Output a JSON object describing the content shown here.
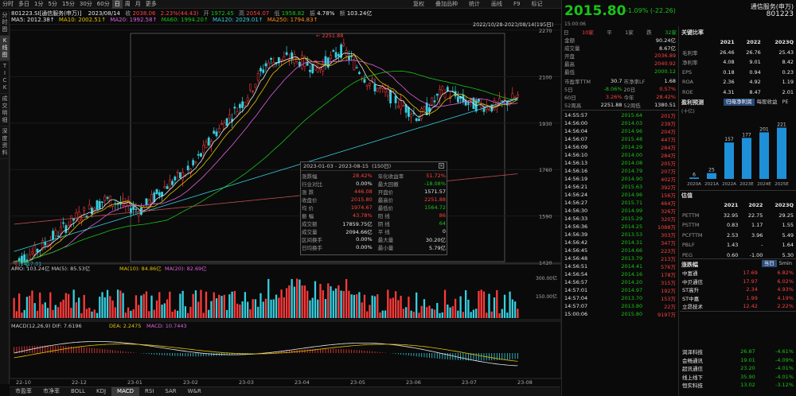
{
  "window": {
    "symbol_line": "801223.SI[通信服务(申万)]",
    "date": "2023/08/14",
    "close_label": "收",
    "close": "2038.06",
    "chg_pct": "2.23%(44.43)",
    "open_label": "开",
    "open": "1972.45",
    "high_label": "高",
    "high": "2054.07",
    "low_label": "低",
    "low": "1958.82",
    "amp_label": "振",
    "amp": "4.78%",
    "vol_label": "额",
    "vol": "103.24亿"
  },
  "period_tabs": [
    "分时",
    "多日",
    "1分",
    "5分",
    "15分",
    "30分",
    "60分",
    "日",
    "周",
    "月",
    "更多"
  ],
  "active_period": "日",
  "toolbar": [
    "复权",
    "叠加品种",
    "统计",
    "画线",
    "F9",
    "标记"
  ],
  "left_tabs": [
    "分时图",
    "K线图",
    "TICK",
    "成交明细",
    "深度资料"
  ],
  "ma_line": {
    "ma5": "MA5: 2012.38↑",
    "ma10": "MA10: 2002.51↑",
    "ma20": "MA20: 1992.58↑",
    "ma60": "MA60: 1994.20↑",
    "ma120": "MA120: 2029.01↑",
    "ma250": "MA250: 1794.83↑"
  },
  "range_label": "2022/10/28-2023/08/14(195日)",
  "price_axis": [
    "2270",
    "2100",
    "1930",
    "1760",
    "1590",
    "1420"
  ],
  "high_marker": "2251.88",
  "low_marker": "1417.01",
  "stats_box": {
    "date_from": "2023-01-03",
    "date_to": "2023-08-15",
    "days": "(150日)",
    "rows": [
      [
        "涨跌幅",
        "28.42%",
        "年化收益率",
        "51.72%"
      ],
      [
        "行业对比",
        "0.00%",
        "最大回撤",
        "-18.08%"
      ],
      [
        "涨 跌",
        "446.08",
        "开盘价",
        "1571.57"
      ],
      [
        "收盘价",
        "2015.80",
        "最高价",
        "2251.88"
      ],
      [
        "均 价",
        "1974.67",
        "最低价",
        "1564.72"
      ],
      [
        "振 幅",
        "43.78%",
        "阳 线",
        "86"
      ],
      [
        "成交额",
        "17859.75亿",
        "阴 线",
        "64"
      ],
      [
        "成交量",
        "2094.66亿",
        "平 线",
        "0"
      ],
      [
        "区间换手",
        "0.00%",
        "最大量",
        "30.20亿"
      ],
      [
        "日均换手",
        "0.00%",
        "最小量",
        "5.79亿"
      ]
    ]
  },
  "amo_line": {
    "amo": "AMO: 103.24亿",
    "ma5": "MA(5): 85.53亿",
    "ma10": "MA(10): 84.86亿",
    "ma20": "MA(20): 82.69亿"
  },
  "amo_axis": [
    "300.00亿",
    "150.00亿"
  ],
  "macd_line": {
    "name": "MACD(12,26,9)",
    "dif": "DIF: 7.6196",
    "dea": "DEA: 2.2475",
    "macd": "MACD: 10.7443"
  },
  "date_axis": [
    "22-10",
    "22-12",
    "23-01",
    "23-02",
    "23-03",
    "23-04",
    "23-05",
    "23-06",
    "23-07",
    "23-08"
  ],
  "bottom_tabs": [
    "市盈率",
    "市净率",
    "BOLL",
    "KDJ",
    "MACD",
    "RSI",
    "SAR",
    "W&R"
  ],
  "active_bottom": "MACD",
  "quote": {
    "price": "2015.80",
    "change": "-1.09% (-22.26)",
    "name": "通信服务(申万)",
    "code": "801223",
    "time": "15:00:06",
    "sub": "申万二级行业指数",
    "levels_head": [
      "日",
      "10家",
      "平",
      "1家",
      "跌",
      "32家"
    ],
    "kv": [
      [
        "金额",
        "90.24亿"
      ],
      [
        "成交量",
        "8.67亿"
      ],
      [
        "开盘",
        "2036.89"
      ],
      [
        "最高",
        "2040.92"
      ],
      [
        "最低",
        "2000.12"
      ]
    ],
    "pe_row": [
      "市盈率TTM",
      "30.7",
      "市净率LF",
      "1.68"
    ],
    "ret_rows": [
      [
        "5日",
        "-8.06%",
        "20日",
        "0.57%"
      ],
      [
        "60日",
        "3.26%",
        "今年",
        "28.42%"
      ],
      [
        "52周高",
        "2251.88",
        "52周低",
        "1380.51"
      ]
    ]
  },
  "ticks": [
    [
      "14:55:57",
      "2015.64",
      "201万"
    ],
    [
      "14:56:00",
      "2014.03",
      "239万"
    ],
    [
      "14:56:04",
      "2014.96",
      "204万"
    ],
    [
      "14:56:07",
      "2015.48",
      "447万"
    ],
    [
      "14:56:09",
      "2014.29",
      "284万"
    ],
    [
      "14:56:10",
      "2014.00",
      "284万"
    ],
    [
      "14:56:13",
      "2014.08",
      "205万"
    ],
    [
      "14:56:16",
      "2014.79",
      "207万"
    ],
    [
      "14:56:19",
      "2014.90",
      "402万"
    ],
    [
      "14:56:21",
      "2015.63",
      "392万"
    ],
    [
      "14:56:24",
      "2014.96",
      "156万"
    ],
    [
      "14:56:27",
      "2015.71",
      "464万"
    ],
    [
      "14:56:30",
      "2014.99",
      "326万"
    ],
    [
      "14:56:33",
      "2015.29",
      "320万"
    ],
    [
      "14:56:36",
      "2014.25",
      "1088万"
    ],
    [
      "14:56:39",
      "2013.53",
      "303万"
    ],
    [
      "14:56:42",
      "2014.31",
      "347万"
    ],
    [
      "14:56:45",
      "2014.66",
      "223万"
    ],
    [
      "14:56:48",
      "2013.79",
      "213万"
    ],
    [
      "14:56:51",
      "2014.41",
      "576万"
    ],
    [
      "14:56:54",
      "2014.16",
      "178万"
    ],
    [
      "14:56:57",
      "2014.20",
      "315万"
    ],
    [
      "14:57:01",
      "2014.97",
      "192万"
    ],
    [
      "14:57:04",
      "2013.70",
      "153万"
    ],
    [
      "14:57:07",
      "2013.80",
      "22万"
    ],
    [
      "15:00:06",
      "2015.80",
      "9197万"
    ]
  ],
  "fin": {
    "title": "关键比率",
    "years": [
      "2021",
      "2022",
      "2023Q"
    ],
    "rows": [
      [
        "毛利率",
        "26.46",
        "26.76",
        "25.43"
      ],
      [
        "净利率",
        "4.08",
        "9.01",
        "8.42"
      ],
      [
        "EPS",
        "0.18",
        "0.94",
        "0.23"
      ],
      [
        "ROA",
        "2.36",
        "4.92",
        "1.19"
      ],
      [
        "ROE",
        "4.31",
        "8.47",
        "2.01"
      ]
    ]
  },
  "forecast": {
    "title": "盈利预测",
    "sub": "(十亿)",
    "tabs": [
      "归母净利润",
      "每股收益",
      "PE"
    ],
    "categories": [
      "2020A",
      "2021A",
      "2022A",
      "2023E",
      "2024E",
      "2025E"
    ],
    "values": [
      6,
      25,
      157,
      177,
      201,
      221
    ]
  },
  "valuation": {
    "title": "估值",
    "years": [
      "2021",
      "2022",
      "2023Q"
    ],
    "rows": [
      [
        "PETTM",
        "32.95",
        "22.75",
        "29.25"
      ],
      [
        "PSTTM",
        "0.83",
        "1.17",
        "1.55"
      ],
      [
        "PCFTTM",
        "2.53",
        "3.96",
        "5.49"
      ],
      [
        "PBLF",
        "1.43",
        "-",
        "1.64"
      ],
      [
        "PEG",
        "0.60",
        "-1.00",
        "5.30"
      ]
    ]
  },
  "movers": {
    "title": "涨跌幅",
    "tabs": [
      "当日",
      "5min"
    ],
    "rows": [
      [
        "中富通",
        "17.69",
        "6.82%"
      ],
      [
        "中贝通信",
        "17.97",
        "6.02%"
      ],
      [
        "ST高升",
        "2.34",
        "4.93%"
      ],
      [
        "ST中嘉",
        "1.99",
        "4.19%"
      ],
      [
        "立昂技术",
        "12.42",
        "2.22%"
      ]
    ],
    "down": [
      [
        "润泽科技",
        "26.87",
        "-4.61%"
      ],
      [
        "会畅通讯",
        "19.01",
        "-4.09%"
      ],
      [
        "超讯通信",
        "23.20",
        "-4.01%"
      ],
      [
        "线上线下",
        "35.90",
        "-4.01%"
      ],
      [
        "恒实科技",
        "13.02",
        "-3.12%"
      ]
    ]
  }
}
